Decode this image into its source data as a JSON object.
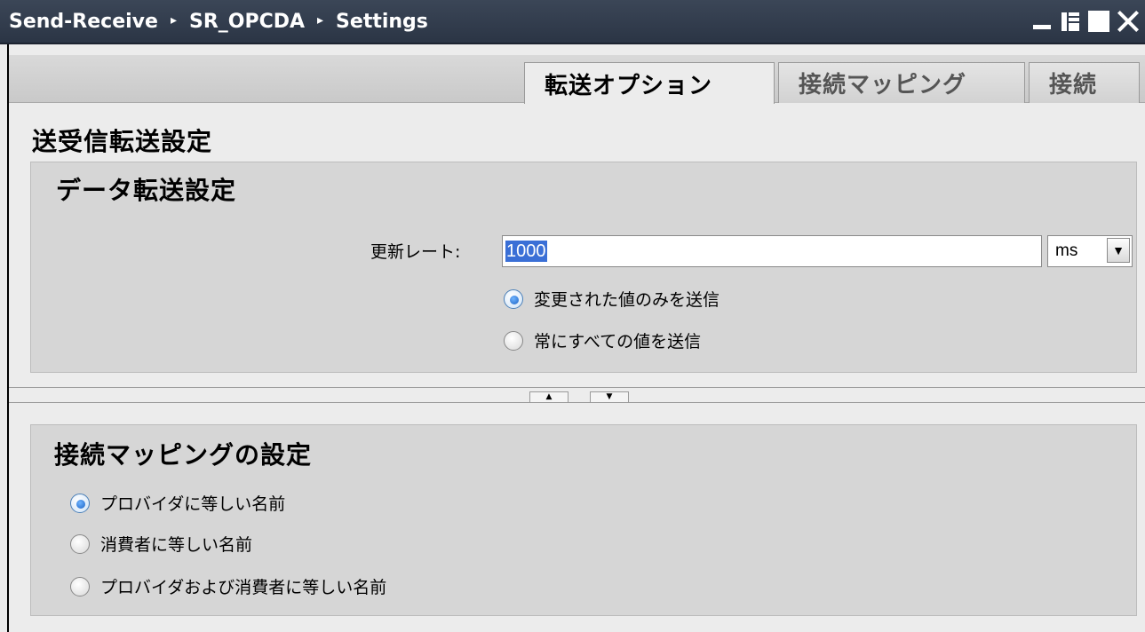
{
  "titlebar": {
    "breadcrumbs": [
      "Send-Receive",
      "SR_OPCDA",
      "Settings"
    ],
    "separator": "▸"
  },
  "tabs": [
    {
      "label": "転送オプション",
      "active": true
    },
    {
      "label": "接続マッピング",
      "active": false
    },
    {
      "label": "接続",
      "active": false
    }
  ],
  "page_title": "送受信転送設定",
  "data_transfer": {
    "title": "データ転送設定",
    "update_rate_label": "更新レート:",
    "update_rate_value": "1000",
    "unit": "ms",
    "options": [
      {
        "label": "変更された値のみを送信",
        "checked": true
      },
      {
        "label": "常にすべての値を送信",
        "checked": false
      }
    ]
  },
  "splitter": {
    "up": "▲",
    "down": "▼"
  },
  "mapping": {
    "title": "接続マッピングの設定",
    "options": [
      {
        "label": "プロバイダに等しい名前",
        "checked": true
      },
      {
        "label": "消費者に等しい名前",
        "checked": false
      },
      {
        "label": "プロバイダおよび消費者に等しい名前",
        "checked": false
      }
    ]
  },
  "colors": {
    "titlebar": "#2f3a4a",
    "radio_accent": "#1d63c4",
    "selection": "#3a6fd6"
  }
}
